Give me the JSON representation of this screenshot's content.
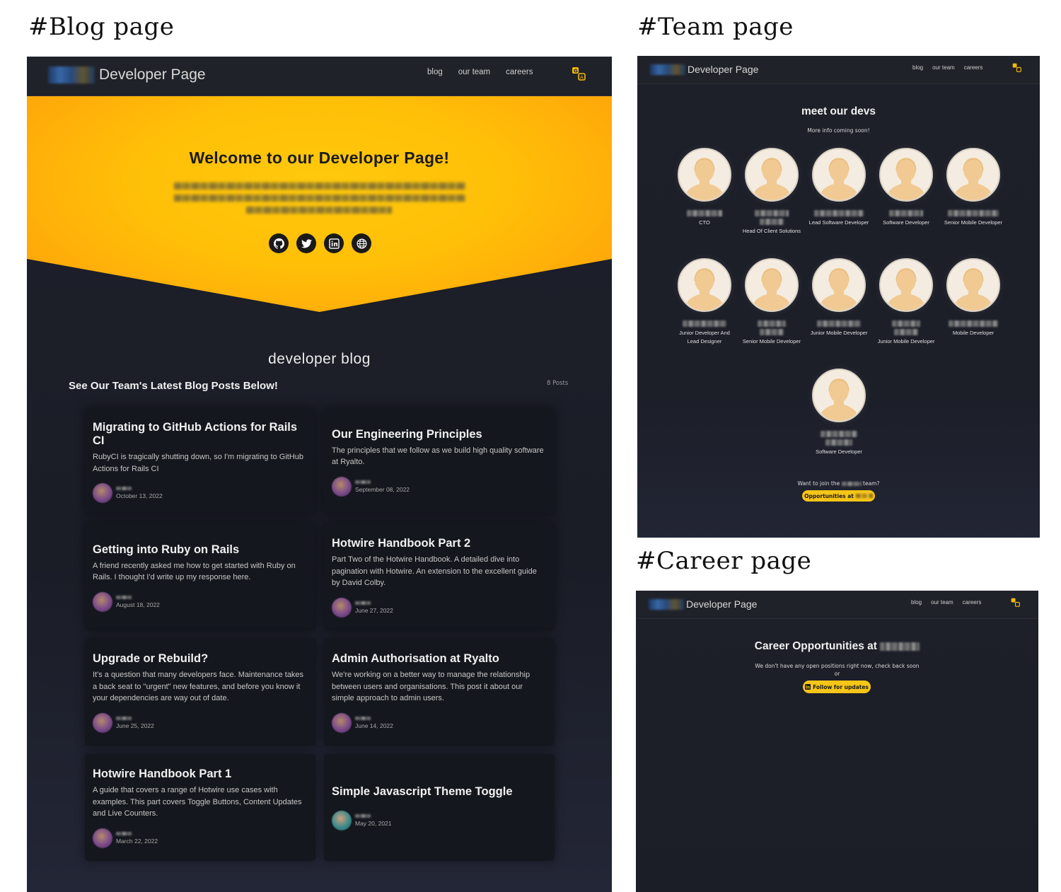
{
  "sections": {
    "blog": "#Blog page",
    "team": "#Team page",
    "career": "#Career page"
  },
  "nav": {
    "brand": "Developer Page",
    "links": [
      "blog",
      "our team",
      "careers"
    ]
  },
  "hero": {
    "title": "Welcome to our Developer Page!",
    "socials": [
      "github-icon",
      "twitter-icon",
      "linkedin-icon",
      "globe-icon"
    ]
  },
  "blog": {
    "heading": "developer blog",
    "subheading": "See Our Team's Latest Blog Posts Below!",
    "count": "8 Posts",
    "posts": [
      {
        "title": "Migrating to GitHub Actions for Rails CI",
        "desc": "RubyCI is tragically shutting down, so I'm migrating to GitHub Actions for Rails CI",
        "date": "October 13, 2022"
      },
      {
        "title": "Our Engineering Principles",
        "desc": "The principles that we follow as we build high quality software at Ryalto.",
        "date": "September 08, 2022"
      },
      {
        "title": "Getting into Ruby on Rails",
        "desc": "A friend recently asked me how to get started with Ruby on Rails. I thought I'd write up my response here.",
        "date": "August 18, 2022"
      },
      {
        "title": "Hotwire Handbook Part 2",
        "desc": "Part Two of the Hotwire Handbook. A detailed dive into pagination with Hotwire. An extension to the excellent guide by David Colby.",
        "date": "June 27, 2022"
      },
      {
        "title": "Upgrade or Rebuild?",
        "desc": "It's a question that many developers face. Maintenance takes a back seat to \"urgent\" new features, and before you know it your dependencies are way out of date.",
        "date": "June 25, 2022"
      },
      {
        "title": "Admin Authorisation at Ryalto",
        "desc": "We're working on a better way to manage the relationship between users and organisations. This post it about our simple approach to admin users.",
        "date": "June 14, 2022"
      },
      {
        "title": "Hotwire Handbook Part 1",
        "desc": "A guide that covers a range of Hotwire use cases with examples. This part covers Toggle Buttons, Content Updates and Live Counters.",
        "date": "March 22, 2022"
      },
      {
        "title": "Simple Javascript Theme Toggle",
        "desc": "",
        "date": "May 20, 2021"
      }
    ]
  },
  "team": {
    "title": "meet our devs",
    "subtitle": "More info coming soon!",
    "members": [
      {
        "role": "CTO"
      },
      {
        "role": "Head Of Client Solutions"
      },
      {
        "role": "Lead Software Developer"
      },
      {
        "role": "Software Developer"
      },
      {
        "role": "Senior Mobile Developer"
      },
      {
        "role": "Junior Developer And Lead Designer"
      },
      {
        "role": "Senior Mobile Developer"
      },
      {
        "role": "Junior Mobile Developer"
      },
      {
        "role": "Junior Mobile Developer"
      },
      {
        "role": "Mobile Developer"
      },
      {
        "role": "Software Developer"
      }
    ],
    "join_prefix": "Want to join the",
    "join_suffix": "team?",
    "button": "Opportunities at"
  },
  "career": {
    "title": "Career Opportunities at",
    "subtitle": "We don't have any open positions right now, check back soon",
    "or": "or",
    "button": "Follow for updates"
  },
  "colors": {
    "accent": "#f5c518",
    "hero": "#ffbf08",
    "background": "#1d1f2b",
    "card": "#15171e"
  }
}
